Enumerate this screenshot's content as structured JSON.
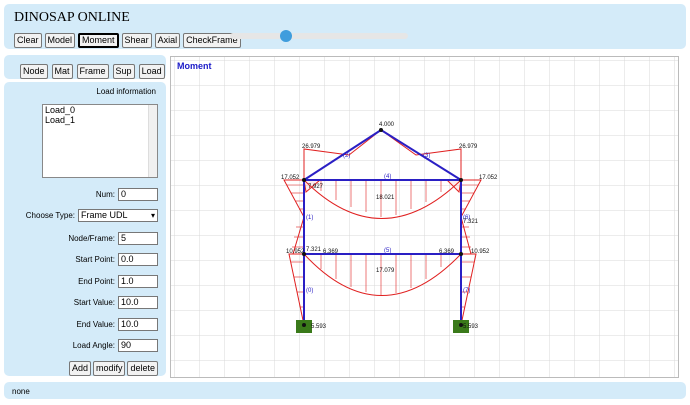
{
  "app": {
    "title": "DINOSAP ONLINE"
  },
  "toolbar": {
    "buttons": [
      {
        "label": "Clear",
        "active": false
      },
      {
        "label": "Model",
        "active": false
      },
      {
        "label": "Moment",
        "active": true
      },
      {
        "label": "Shear",
        "active": false
      },
      {
        "label": "Axial",
        "active": false
      },
      {
        "label": "CheckFrame",
        "active": false
      }
    ],
    "slider_fraction": 0.32
  },
  "tabs": [
    "Node",
    "Mat",
    "Frame",
    "Sup",
    "Load"
  ],
  "side": {
    "header": "Load information",
    "loads": [
      "Load_0",
      "Load_1"
    ],
    "num_label": "Num:",
    "num_value": "0",
    "type_label": "Choose Type:",
    "type_value": "Frame UDL",
    "node_frame_label": "Node/Frame:",
    "node_frame_value": "5",
    "start_point_label": "Start Point:",
    "start_point_value": "0.0",
    "end_point_label": "End Point:",
    "end_point_value": "1.0",
    "start_value_label": "Start Value:",
    "start_value_value": "10.0",
    "end_value_label": "End Value:",
    "end_value_value": "10.0",
    "load_angle_label": "Load Angle:",
    "load_angle_value": "90",
    "buttons": [
      "Add",
      "modify",
      "delete"
    ]
  },
  "canvas": {
    "title": "Moment"
  },
  "diagram_labels": {
    "apex": "4.000",
    "left_top": "26.979",
    "right_top": "26.979",
    "left_joint": "17.052",
    "right_joint": "17.052",
    "left_inner": "7.927",
    "upper_beam": "18.021",
    "left_mid": "7.321",
    "right_mid": "7.321",
    "left_lower": "10.952",
    "right_lower": "10.952",
    "lower_left_inner": "6.369",
    "lower_right_inner": "6.369",
    "lower_beam": "17.079",
    "base_left": "5.593",
    "base_right": "5.593",
    "frames": [
      "(0)",
      "(1)",
      "(2)",
      "(3)",
      "(4)",
      "(5)",
      "(6)",
      "(7)"
    ]
  },
  "status": {
    "text": "none"
  },
  "colors": {
    "panel": "#d4ebf9",
    "frame": "#2a1fc4",
    "moment": "#e02020",
    "support": "#3a7a1a",
    "title": "#1b1bc8"
  }
}
